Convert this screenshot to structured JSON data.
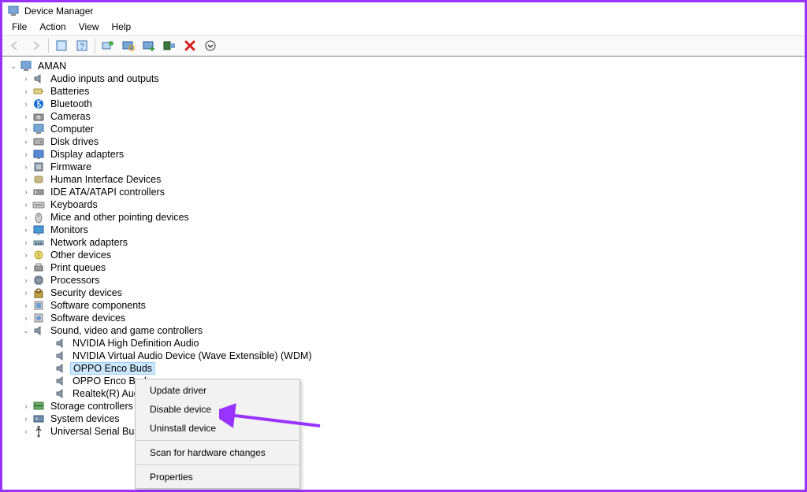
{
  "title": "Device Manager",
  "menubar": [
    "File",
    "Action",
    "View",
    "Help"
  ],
  "toolbar": [
    {
      "name": "back",
      "icon": "arrow-left",
      "disabled": true
    },
    {
      "name": "forward",
      "icon": "arrow-right",
      "disabled": true
    },
    {
      "sep": true
    },
    {
      "name": "show-hidden",
      "icon": "box-blue"
    },
    {
      "name": "help",
      "icon": "help"
    },
    {
      "sep": true
    },
    {
      "name": "update-driver",
      "icon": "update"
    },
    {
      "name": "scan-hardware",
      "icon": "monitor-search"
    },
    {
      "name": "add-legacy",
      "icon": "monitor-plus"
    },
    {
      "name": "uninstall",
      "icon": "computer-x"
    },
    {
      "name": "properties",
      "icon": "delete-red"
    },
    {
      "name": "enable-disable",
      "icon": "circle-down"
    }
  ],
  "tree": [
    {
      "depth": 0,
      "exp": "open",
      "icon": "computer",
      "label": "AMAN"
    },
    {
      "depth": 1,
      "exp": "closed",
      "icon": "audio",
      "label": "Audio inputs and outputs"
    },
    {
      "depth": 1,
      "exp": "closed",
      "icon": "battery",
      "label": "Batteries"
    },
    {
      "depth": 1,
      "exp": "closed",
      "icon": "bluetooth",
      "label": "Bluetooth"
    },
    {
      "depth": 1,
      "exp": "closed",
      "icon": "camera",
      "label": "Cameras"
    },
    {
      "depth": 1,
      "exp": "closed",
      "icon": "computer",
      "label": "Computer"
    },
    {
      "depth": 1,
      "exp": "closed",
      "icon": "disk",
      "label": "Disk drives"
    },
    {
      "depth": 1,
      "exp": "closed",
      "icon": "display",
      "label": "Display adapters"
    },
    {
      "depth": 1,
      "exp": "closed",
      "icon": "firmware",
      "label": "Firmware"
    },
    {
      "depth": 1,
      "exp": "closed",
      "icon": "hid",
      "label": "Human Interface Devices"
    },
    {
      "depth": 1,
      "exp": "closed",
      "icon": "ide",
      "label": "IDE ATA/ATAPI controllers"
    },
    {
      "depth": 1,
      "exp": "closed",
      "icon": "keyboard",
      "label": "Keyboards"
    },
    {
      "depth": 1,
      "exp": "closed",
      "icon": "mouse",
      "label": "Mice and other pointing devices"
    },
    {
      "depth": 1,
      "exp": "closed",
      "icon": "monitor",
      "label": "Monitors"
    },
    {
      "depth": 1,
      "exp": "closed",
      "icon": "network",
      "label": "Network adapters"
    },
    {
      "depth": 1,
      "exp": "closed",
      "icon": "other",
      "label": "Other devices"
    },
    {
      "depth": 1,
      "exp": "closed",
      "icon": "printer",
      "label": "Print queues"
    },
    {
      "depth": 1,
      "exp": "closed",
      "icon": "cpu",
      "label": "Processors"
    },
    {
      "depth": 1,
      "exp": "closed",
      "icon": "security",
      "label": "Security devices"
    },
    {
      "depth": 1,
      "exp": "closed",
      "icon": "component",
      "label": "Software components"
    },
    {
      "depth": 1,
      "exp": "closed",
      "icon": "software",
      "label": "Software devices"
    },
    {
      "depth": 1,
      "exp": "open",
      "icon": "audio",
      "label": "Sound, video and game controllers"
    },
    {
      "depth": 2,
      "exp": "none",
      "icon": "audio",
      "label": "NVIDIA High Definition Audio"
    },
    {
      "depth": 2,
      "exp": "none",
      "icon": "audio",
      "label": "NVIDIA Virtual Audio Device (Wave Extensible) (WDM)"
    },
    {
      "depth": 2,
      "exp": "none",
      "icon": "audio",
      "label": "OPPO Enco Buds",
      "selected": true
    },
    {
      "depth": 2,
      "exp": "none",
      "icon": "audio",
      "label": "OPPO Enco Buds"
    },
    {
      "depth": 2,
      "exp": "none",
      "icon": "audio",
      "label": "Realtek(R) Audio"
    },
    {
      "depth": 1,
      "exp": "closed",
      "icon": "storage",
      "label": "Storage controllers"
    },
    {
      "depth": 1,
      "exp": "closed",
      "icon": "system",
      "label": "System devices"
    },
    {
      "depth": 1,
      "exp": "closed",
      "icon": "usb",
      "label": "Universal Serial Bus"
    }
  ],
  "context_menu": {
    "items": [
      {
        "label": "Update driver"
      },
      {
        "label": "Disable device"
      },
      {
        "label": "Uninstall device"
      },
      {
        "sep": true
      },
      {
        "label": "Scan for hardware changes"
      },
      {
        "sep": true
      },
      {
        "label": "Properties"
      }
    ]
  }
}
